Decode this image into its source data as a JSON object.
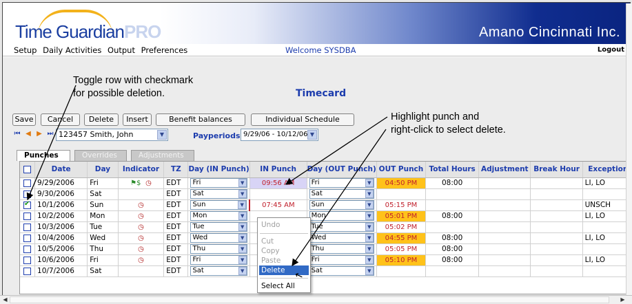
{
  "app": {
    "logo_text": "Time Guardian",
    "logo_pro": "PRO",
    "company": "Amano Cincinnati Inc.",
    "menu": [
      "Setup",
      "Daily Activities",
      "Output",
      "Preferences"
    ],
    "welcome": "Welcome SYSDBA",
    "logout": "Logout"
  },
  "page": {
    "title": "Timecard"
  },
  "annotations": {
    "left_line1": "Toggle row with checkmark",
    "left_line2": "for possible deletion.",
    "right_line1": "Highlight punch and",
    "right_line2": "right-click to select delete."
  },
  "toolbar": {
    "save": "Save",
    "cancel": "Cancel",
    "delete": "Delete",
    "insert": "Insert",
    "benefit": "Benefit balances",
    "schedule": "Individual Schedule"
  },
  "employee": {
    "selected": "123457 Smith, John",
    "payperiods_label": "Payperiods",
    "payperiod": "9/29/06 - 10/12/06"
  },
  "tabs": [
    "Punches",
    "Overrides",
    "Adjustments"
  ],
  "grid": {
    "columns": [
      "",
      "Date",
      "Day",
      "Indicator",
      "TZ",
      "Day (IN Punch)",
      "IN Punch",
      "Day (OUT Punch)",
      "OUT Punch",
      "Total Hours",
      "Adjustment",
      "Break Hour",
      "Exception"
    ],
    "rows": [
      {
        "checked": false,
        "date": "9/29/2006",
        "day": "Fri",
        "flag": true,
        "clock": true,
        "tz": "EDT",
        "in_day": "Fri",
        "in_punch": "09:56 AM",
        "in_lav": true,
        "out_day": "Fri",
        "out_punch": "04:50 PM",
        "out_orange": true,
        "total": "08:00",
        "adjustment": "",
        "break": "",
        "exception": "LI, LO"
      },
      {
        "checked": false,
        "date": "9/30/2006",
        "day": "Sat",
        "flag": false,
        "clock": false,
        "tz": "EDT",
        "in_day": "Sat",
        "in_punch": "",
        "in_lav": false,
        "out_day": "Sat",
        "out_punch": "",
        "out_orange": false,
        "total": "",
        "adjustment": "",
        "break": "",
        "exception": ""
      },
      {
        "checked": true,
        "date": "10/1/2006",
        "day": "Sun",
        "flag": false,
        "clock": true,
        "tz": "EDT",
        "in_day": "Sun",
        "in_punch": "07:45 AM",
        "in_lav": false,
        "out_day": "Sun",
        "out_punch": "05:15 PM",
        "out_orange": false,
        "total": "",
        "adjustment": "",
        "break": "",
        "exception": "UNSCH"
      },
      {
        "checked": false,
        "date": "10/2/2006",
        "day": "Mon",
        "flag": false,
        "clock": true,
        "tz": "EDT",
        "in_day": "Mon",
        "in_punch": "",
        "in_lav": false,
        "out_day": "Mon",
        "out_punch": "05:01 PM",
        "out_orange": true,
        "total": "08:00",
        "adjustment": "",
        "break": "",
        "exception": "LI, LO"
      },
      {
        "checked": false,
        "date": "10/3/2006",
        "day": "Tue",
        "flag": false,
        "clock": true,
        "tz": "EDT",
        "in_day": "Tue",
        "in_punch": "",
        "in_lav": false,
        "out_day": "Tue",
        "out_punch": "05:02 PM",
        "out_orange": false,
        "total": "",
        "adjustment": "",
        "break": "",
        "exception": ""
      },
      {
        "checked": false,
        "date": "10/4/2006",
        "day": "Wed",
        "flag": false,
        "clock": true,
        "tz": "EDT",
        "in_day": "Wed",
        "in_punch": "",
        "in_lav": false,
        "out_day": "Wed",
        "out_punch": "04:55 PM",
        "out_orange": true,
        "total": "08:00",
        "adjustment": "",
        "break": "",
        "exception": "LI, LO"
      },
      {
        "checked": false,
        "date": "10/5/2006",
        "day": "Thu",
        "flag": false,
        "clock": true,
        "tz": "EDT",
        "in_day": "Thu",
        "in_punch": "",
        "in_lav": false,
        "out_day": "Thu",
        "out_punch": "05:05 PM",
        "out_orange": false,
        "total": "08:00",
        "adjustment": "",
        "break": "",
        "exception": ""
      },
      {
        "checked": false,
        "date": "10/6/2006",
        "day": "Fri",
        "flag": false,
        "clock": true,
        "tz": "EDT",
        "in_day": "Fri",
        "in_punch": "",
        "in_lav": false,
        "out_day": "Fri",
        "out_punch": "05:10 PM",
        "out_orange": true,
        "total": "08:00",
        "adjustment": "",
        "break": "",
        "exception": "LI, LO"
      },
      {
        "checked": false,
        "date": "10/7/2006",
        "day": "Sat",
        "flag": false,
        "clock": false,
        "tz": "EDT",
        "in_day": "Sat",
        "in_punch": "",
        "in_lav": false,
        "out_day": "Sat",
        "out_punch": "",
        "out_orange": false,
        "total": "",
        "adjustment": "",
        "break": "",
        "exception": ""
      }
    ]
  },
  "context_menu": {
    "items": [
      {
        "label": "Undo",
        "disabled": true
      },
      {
        "label": "Cut",
        "disabled": true
      },
      {
        "label": "Copy",
        "disabled": true
      },
      {
        "label": "Paste",
        "disabled": true
      },
      {
        "label": "Delete",
        "disabled": false,
        "highlighted": true
      },
      {
        "label": "Select All",
        "disabled": false
      }
    ]
  },
  "colors": {
    "brand_blue": "#1c3cad",
    "punch_red": "#c0202c",
    "orange_highlight": "#ffc21a",
    "lavender_highlight": "#d8d4f6"
  }
}
